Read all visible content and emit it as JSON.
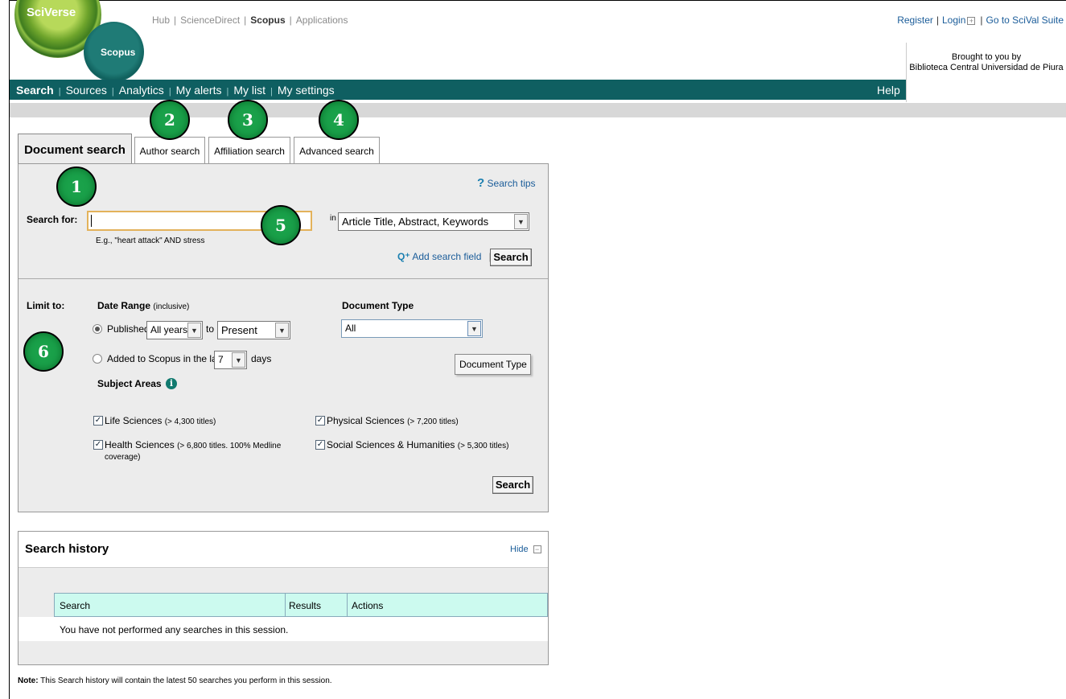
{
  "logos": {
    "sciverse": "SciVerse",
    "scopus": "Scopus"
  },
  "top_links": {
    "hub": "Hub",
    "sciencedirect": "ScienceDirect",
    "scopus": "Scopus",
    "applications": "Applications"
  },
  "account_links": {
    "register": "Register",
    "login": "Login",
    "scival": "Go to SciVal Suite"
  },
  "brought_by": {
    "line1": "Brought to you by",
    "line2": "Biblioteca Central Universidad de Piura"
  },
  "nav": {
    "search": "Search",
    "sources": "Sources",
    "analytics": "Analytics",
    "alerts": "My alerts",
    "list": "My list",
    "settings": "My settings",
    "help": "Help"
  },
  "tabs": {
    "document": "Document search",
    "author": "Author search",
    "affiliation": "Affiliation search",
    "advanced": "Advanced search"
  },
  "search": {
    "tips": "Search tips",
    "label": "Search for:",
    "value": "",
    "example": "E.g., \"heart attack\" AND stress",
    "in_label": "in",
    "field_selected": "Article Title, Abstract, Keywords",
    "add_field": "Add search field",
    "button": "Search"
  },
  "limit": {
    "label": "Limit to:",
    "date_range": "Date Range",
    "inclusive": "(inclusive)",
    "published": "Published",
    "from_year": "All years",
    "to": "to",
    "to_year": "Present",
    "added": "Added to Scopus in the last",
    "days_value": "7",
    "days": "days",
    "doc_type_label": "Document Type",
    "doc_type_value": "All",
    "doc_type_tooltip": "Document Type",
    "subject_areas": "Subject Areas",
    "subjects": [
      {
        "name": "Life Sciences",
        "detail": "(> 4,300 titles)",
        "checked": true
      },
      {
        "name": "Physical Sciences",
        "detail": "(> 7,200 titles)",
        "checked": true
      },
      {
        "name": "Health Sciences",
        "detail": "(> 6,800 titles. 100% Medline",
        "detail2": "coverage)",
        "checked": true
      },
      {
        "name": "Social Sciences & Humanities",
        "detail": "(> 5,300 titles)",
        "checked": true
      }
    ],
    "button": "Search"
  },
  "history": {
    "title": "Search history",
    "hide": "Hide",
    "columns": [
      "Search",
      "Results",
      "Actions"
    ],
    "empty": "You have not performed any searches in this session.",
    "note_label": "Note:",
    "note": "This Search history will contain the latest 50 searches you perform in this session."
  },
  "markers": [
    "1",
    "2",
    "3",
    "4",
    "5",
    "6"
  ],
  "colors": {
    "nav": "#0f5f61",
    "marker": "#1aa14a",
    "history_header": "#ccfaef"
  }
}
